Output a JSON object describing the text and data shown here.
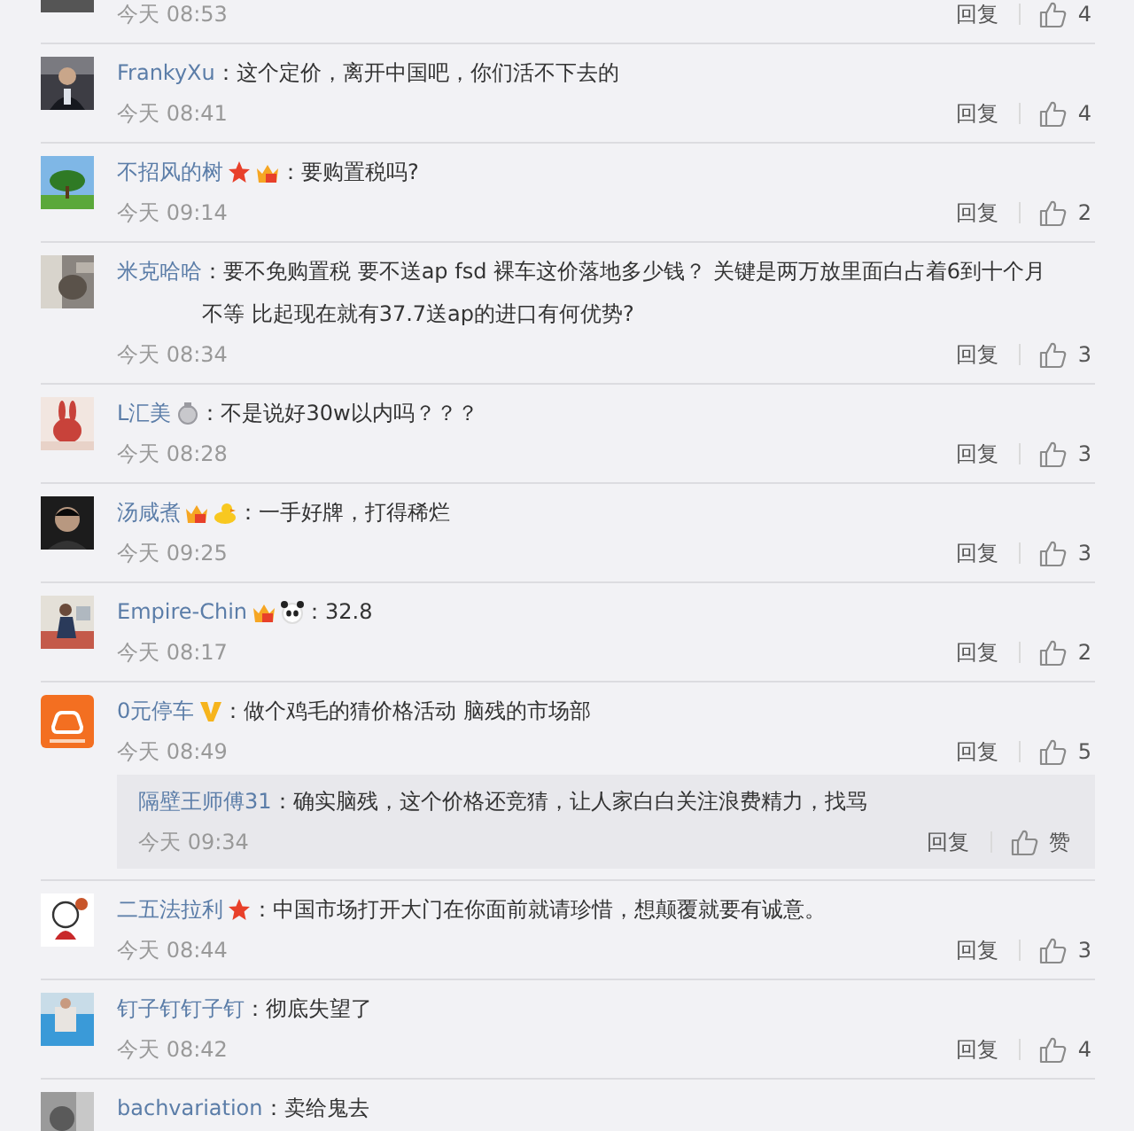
{
  "comments": [
    {
      "avatar": {
        "kind": "picture"
      },
      "time": "今天 08:53",
      "reply": "回复",
      "likes": "4"
    },
    {
      "avatar": {
        "kind": "picture"
      },
      "name": "FrankyXu",
      "text": "：这个定价，离开中国吧，你们活不下去的",
      "time": "今天 08:41",
      "reply": "回复",
      "likes": "4"
    },
    {
      "avatar": {
        "kind": "picture"
      },
      "name": "不招风的树",
      "badges": [
        {
          "kind": "star"
        },
        {
          "kind": "crown"
        }
      ],
      "text": "：要购置税吗?",
      "time": "今天 09:14",
      "reply": "回复",
      "likes": "2"
    },
    {
      "avatar": {
        "kind": "picture"
      },
      "name": "米克哈哈",
      "text": "：要不免购置税 要不送ap fsd 裸车这价落地多少钱？ 关键是两万放里面白占着6到十个月不等 比起现在就有37.7送ap的进口有何优势?",
      "time": "今天 08:34",
      "reply": "回复",
      "likes": "3"
    },
    {
      "avatar": {
        "kind": "picture"
      },
      "name": "L汇美",
      "badges": [
        {
          "kind": "medal"
        }
      ],
      "text": "：不是说好30w以内吗？？？",
      "time": "今天 08:28",
      "reply": "回复",
      "likes": "3"
    },
    {
      "avatar": {
        "kind": "picture"
      },
      "name": "汤咸煮",
      "badges": [
        {
          "kind": "crown"
        },
        {
          "kind": "duck"
        }
      ],
      "text": "：一手好牌，打得稀烂",
      "time": "今天 09:25",
      "reply": "回复",
      "likes": "3"
    },
    {
      "avatar": {
        "kind": "picture"
      },
      "name": "Empire-Chin",
      "badges": [
        {
          "kind": "crown"
        },
        {
          "kind": "panda"
        }
      ],
      "text": "：32.8",
      "time": "今天 08:17",
      "reply": "回复",
      "likes": "2"
    },
    {
      "avatar": {
        "kind": "logo"
      },
      "name": "0元停车",
      "badges": [
        {
          "kind": "verified"
        }
      ],
      "text": "：做个鸡毛的猜价格活动 脑残的市场部",
      "time": "今天 08:49",
      "reply": "回复",
      "likes": "5",
      "replies": [
        {
          "name": "隔壁王师傅31",
          "text": "：确实脑残，这个价格还竞猜，让人家白白关注浪费精力，找骂",
          "time": "今天 09:34",
          "reply": "回复",
          "likes": "赞"
        }
      ]
    },
    {
      "avatar": {
        "kind": "cartoon"
      },
      "name": "二五法拉利",
      "badges": [
        {
          "kind": "star"
        }
      ],
      "text": "：中国市场打开大门在你面前就请珍惜，想颠覆就要有诚意。",
      "time": "今天 08:44",
      "reply": "回复",
      "likes": "3"
    },
    {
      "avatar": {
        "kind": "picture"
      },
      "name": "钉子钉钉子钉",
      "text": "：彻底失望了",
      "time": "今天 08:42",
      "reply": "回复",
      "likes": "4"
    },
    {
      "avatar": {
        "kind": "picture"
      },
      "name": "bachvariation",
      "text": "：卖给鬼去"
    }
  ]
}
